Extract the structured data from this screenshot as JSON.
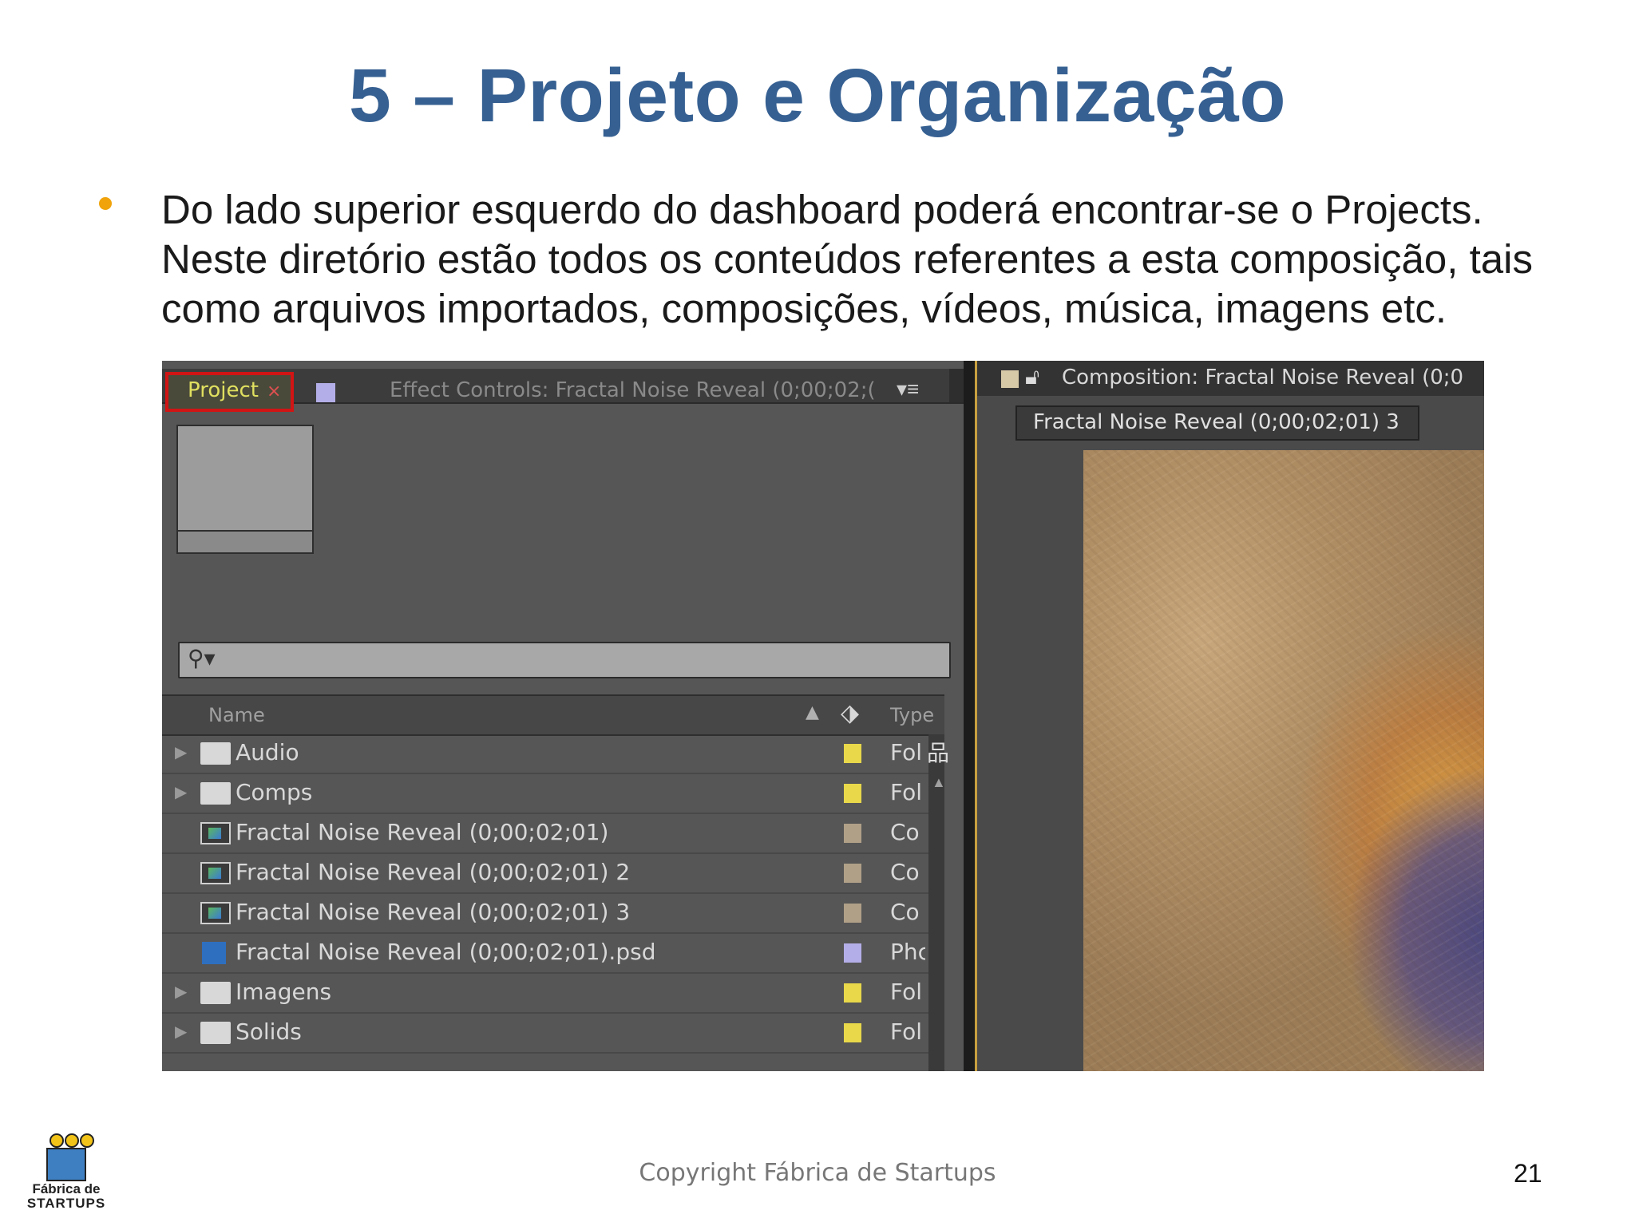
{
  "slide": {
    "title": "5 – Projeto e Organização",
    "bullet_lines": [
      "Do lado superior esquerdo do dashboard poderá encontrar-se o Projects.",
      "Neste diretório estão todos os conteúdos referentes a esta composição, tais",
      "como arquivos importados, composições, vídeos, música, imagens etc."
    ],
    "bullet_color": "#f0a30a",
    "title_color": "#366092",
    "footer": "Copyright Fábrica de Startups",
    "page_number": "21",
    "logo": {
      "line1": "Fábrica de",
      "line2": "STARTUPS"
    }
  },
  "screenshot": {
    "project_panel": {
      "tab_label": "Project",
      "tab_close": "×",
      "effect_controls_tab": "Effect Controls: Fractal Noise Reveal (0;00;02;(",
      "menu_icon": "panel-menu-icon",
      "search_icon": "search-icon",
      "columns": {
        "name": "Name",
        "type": "Type"
      },
      "items": [
        {
          "label": "Audio",
          "kind": "folder",
          "expandable": true,
          "label_color": "#e8d84a",
          "type": "Fol"
        },
        {
          "label": "Comps",
          "kind": "folder",
          "expandable": true,
          "label_color": "#e8d84a",
          "type": "Fol"
        },
        {
          "label": "Fractal Noise Reveal (0;00;02;01)",
          "kind": "comp",
          "expandable": false,
          "label_color": "#b0a088",
          "type": "Co"
        },
        {
          "label": "Fractal Noise Reveal (0;00;02;01) 2",
          "kind": "comp",
          "expandable": false,
          "label_color": "#b0a088",
          "type": "Co"
        },
        {
          "label": "Fractal Noise Reveal (0;00;02;01) 3",
          "kind": "comp",
          "expandable": false,
          "label_color": "#b0a088",
          "type": "Co"
        },
        {
          "label": "Fractal Noise Reveal (0;00;02;01).psd",
          "kind": "psd",
          "expandable": false,
          "label_color": "#b4aee8",
          "type": "Phc"
        },
        {
          "label": "Imagens",
          "kind": "folder",
          "expandable": true,
          "label_color": "#e8d84a",
          "type": "Fol"
        },
        {
          "label": "Solids",
          "kind": "folder",
          "expandable": true,
          "label_color": "#e8d84a",
          "type": "Fol"
        }
      ]
    },
    "composition_panel": {
      "title": "Composition: Fractal Noise Reveal (0;0",
      "active_tab": "Fractal Noise Reveal (0;00;02;01) 3"
    }
  }
}
